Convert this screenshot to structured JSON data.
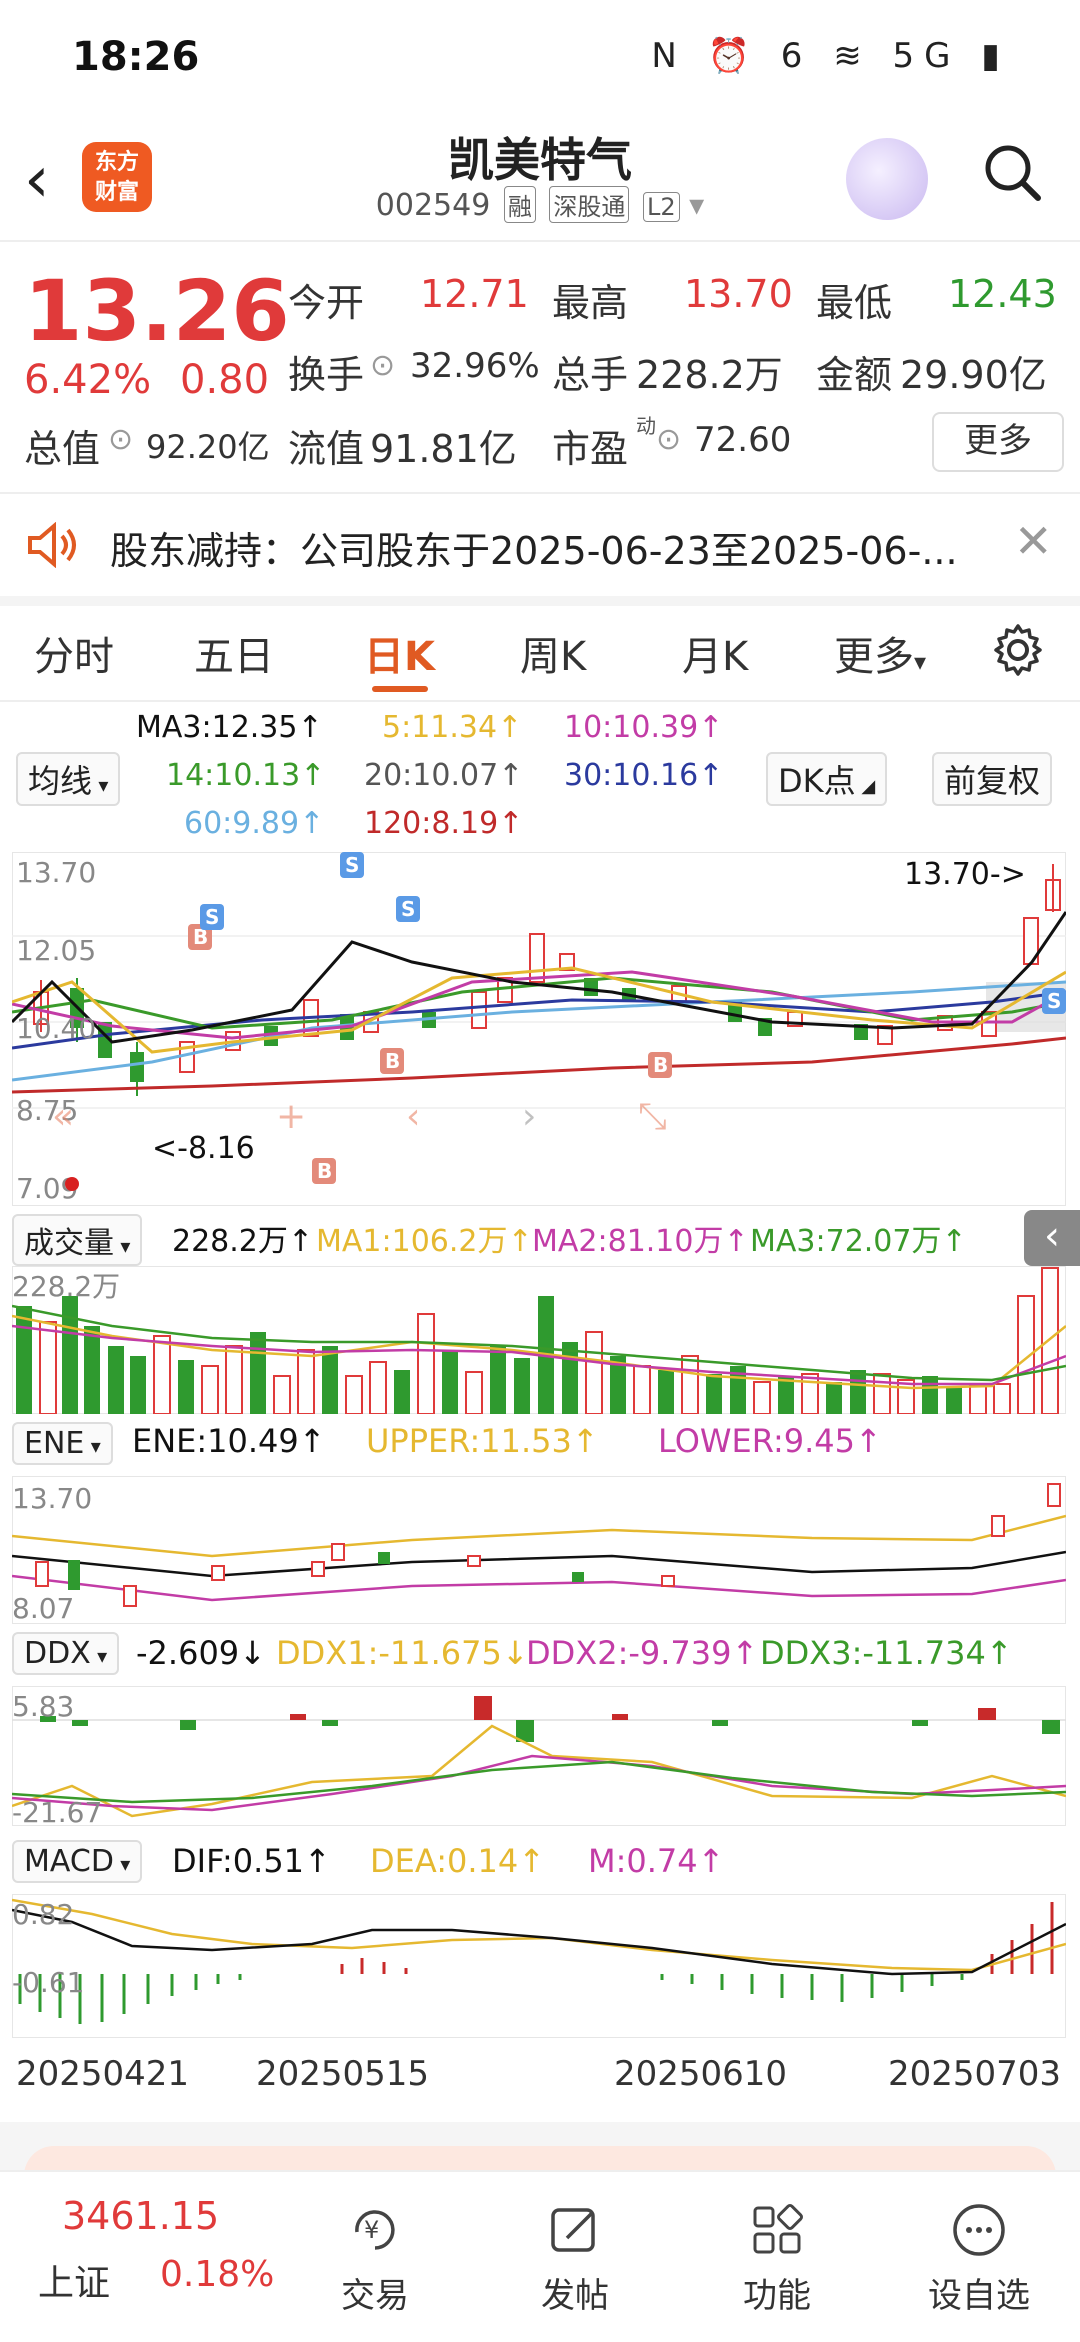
{
  "status_bar": {
    "time": "18:26",
    "icons": "N ⏰ 6 ≋ 5G ▮"
  },
  "header": {
    "stock_name": "凯美特气",
    "code": "002549",
    "tags": [
      "融",
      "深股通",
      "L2"
    ],
    "logo_text": "东方\n财富"
  },
  "quote": {
    "price": "13.26",
    "change_pct": "6.42%",
    "change": "0.80",
    "open_label": "今开",
    "open": "12.71",
    "high_label": "最高",
    "high": "13.70",
    "low_label": "最低",
    "low": "12.43",
    "turnover_label": "换手",
    "turnover": "32.96%",
    "volume_label": "总手",
    "volume": "228.2万",
    "amount_label": "金额",
    "amount": "29.90亿",
    "mcap_label": "总值",
    "mcap": "92.20亿",
    "float_label": "流值",
    "float_value": "91.81亿",
    "pe_label": "市盈",
    "pe_sup": "动",
    "pe": "72.60",
    "more_label": "更多"
  },
  "notice": {
    "text": "股东减持：公司股东于2025-06-23至2025-06-..."
  },
  "tabs": [
    "分时",
    "五日",
    "日K",
    "周K",
    "月K",
    "更多"
  ],
  "active_tab": "日K",
  "ma": {
    "select_label": "均线",
    "ma3": "MA3:12.35↑",
    "ma5": "5:11.34↑",
    "ma10": "10:10.39↑",
    "ma14": "14:10.13↑",
    "ma20": "20:10.07↑",
    "ma30": "30:10.16↑",
    "ma60": "60:9.89↑",
    "ma120": "120:8.19↑",
    "dk_label": "DK点",
    "adjust_label": "前复权"
  },
  "kline": {
    "y_labels": [
      "13.70",
      "12.05",
      "10.40",
      "8.75",
      "7.09"
    ],
    "high_marker": "13.70->",
    "low_marker": "<-8.16"
  },
  "volume": {
    "select_label": "成交量",
    "value": "228.2万↑",
    "ma1": "MA1:106.2万↑",
    "ma2": "MA2:81.10万↑",
    "ma3": "MA3:72.07万↑",
    "y_label": "228.2万"
  },
  "ene": {
    "select_label": "ENE",
    "ene": "ENE:10.49↑",
    "upper": "UPPER:11.53↑",
    "lower": "LOWER:9.45↑",
    "y_top": "13.70",
    "y_bottom": "8.07"
  },
  "ddx": {
    "select_label": "DDX",
    "ddx": "-2.609↓",
    "ddx1": "DDX1:-11.675↓",
    "ddx2": "DDX2:-9.739↑",
    "ddx3": "DDX3:-11.734↑",
    "y_top": "5.83",
    "y_bottom": "-21.67"
  },
  "macd": {
    "select_label": "MACD",
    "dif": "DIF:0.51↑",
    "dea": "DEA:0.14↑",
    "m": "M:0.74↑",
    "y_top": "0.82",
    "y_bottom": "-0.61"
  },
  "dates": [
    "20250421",
    "20250515",
    "20250610",
    "20250703"
  ],
  "bottom_nav": {
    "index_value": "3461.15",
    "index_name": "上证",
    "index_pct": "0.18%",
    "items": [
      "交易",
      "发帖",
      "功能",
      "设自选"
    ]
  },
  "colors": {
    "up": "#e03a3a",
    "down": "#2f9a2f",
    "accent": "#e05a22"
  }
}
